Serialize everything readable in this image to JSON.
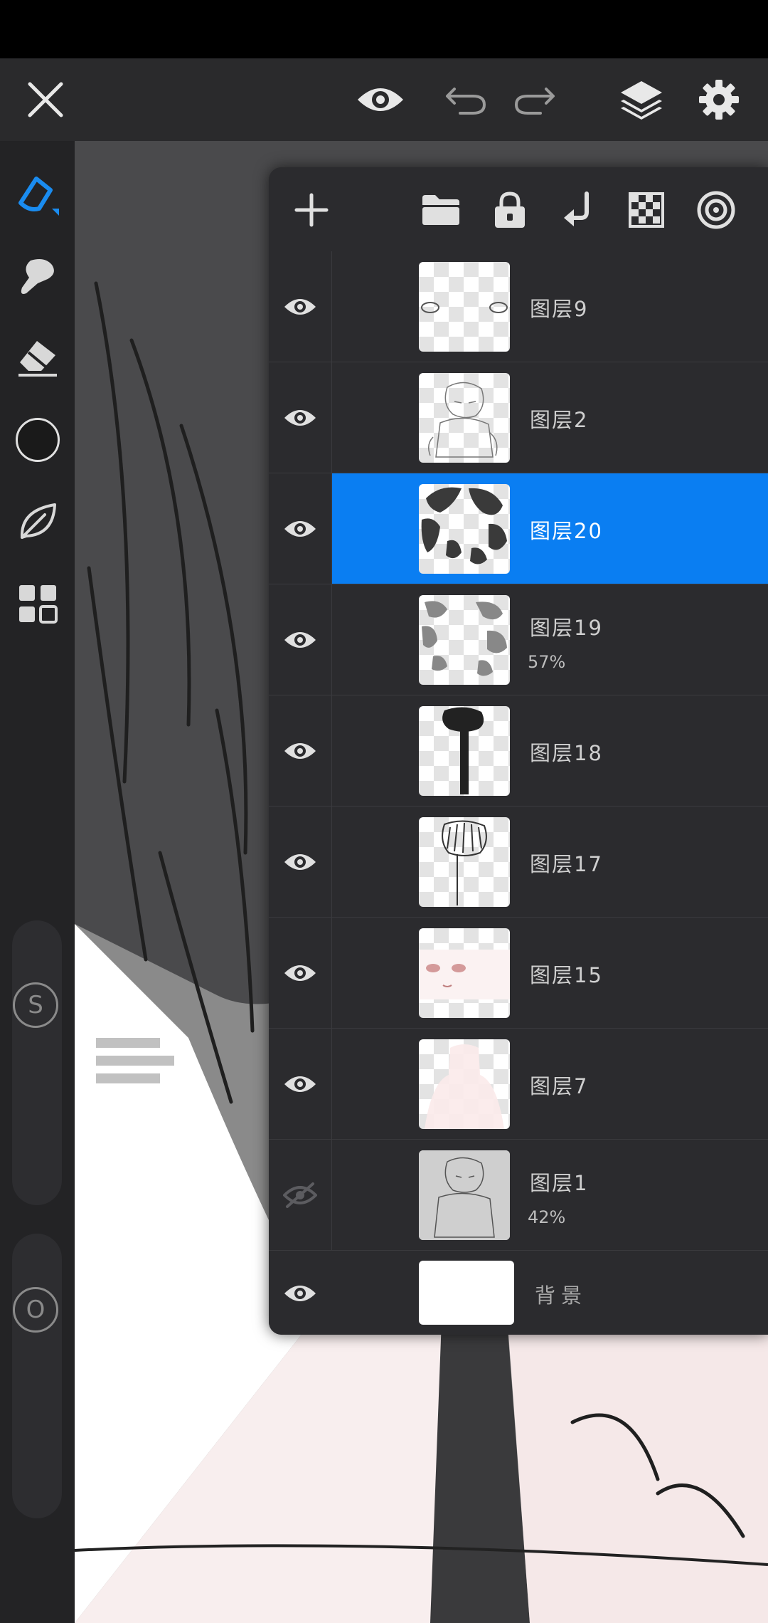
{
  "toolbar": {
    "close": "close",
    "preview": "eye",
    "undo": "undo",
    "redo": "redo",
    "layers": "layers",
    "settings": "gear"
  },
  "tools": [
    "pen",
    "smudge",
    "eraser",
    "color",
    "leaf",
    "grid"
  ],
  "sliders": {
    "size_label": "S",
    "opacity_label": "O"
  },
  "accent_color": "#0a7ef2",
  "layers": [
    {
      "name": "图层9",
      "opacity": "",
      "visible": true,
      "active": false,
      "thumb": "eyes"
    },
    {
      "name": "图层2",
      "opacity": "",
      "visible": true,
      "active": false,
      "thumb": "sketch"
    },
    {
      "name": "图层20",
      "opacity": "",
      "visible": true,
      "active": true,
      "thumb": "hair-dark"
    },
    {
      "name": "图层19",
      "opacity": "57%",
      "visible": true,
      "active": false,
      "thumb": "hair-gray"
    },
    {
      "name": "图层18",
      "opacity": "",
      "visible": true,
      "active": false,
      "thumb": "tie"
    },
    {
      "name": "图层17",
      "opacity": "",
      "visible": true,
      "active": false,
      "thumb": "hair-lines"
    },
    {
      "name": "图层15",
      "opacity": "",
      "visible": true,
      "active": false,
      "thumb": "face"
    },
    {
      "name": "图层7",
      "opacity": "",
      "visible": true,
      "active": false,
      "thumb": "skin"
    },
    {
      "name": "图层1",
      "opacity": "42%",
      "visible": false,
      "active": false,
      "thumb": "photo"
    }
  ],
  "background_layer": {
    "name": "背景",
    "visible": true
  }
}
